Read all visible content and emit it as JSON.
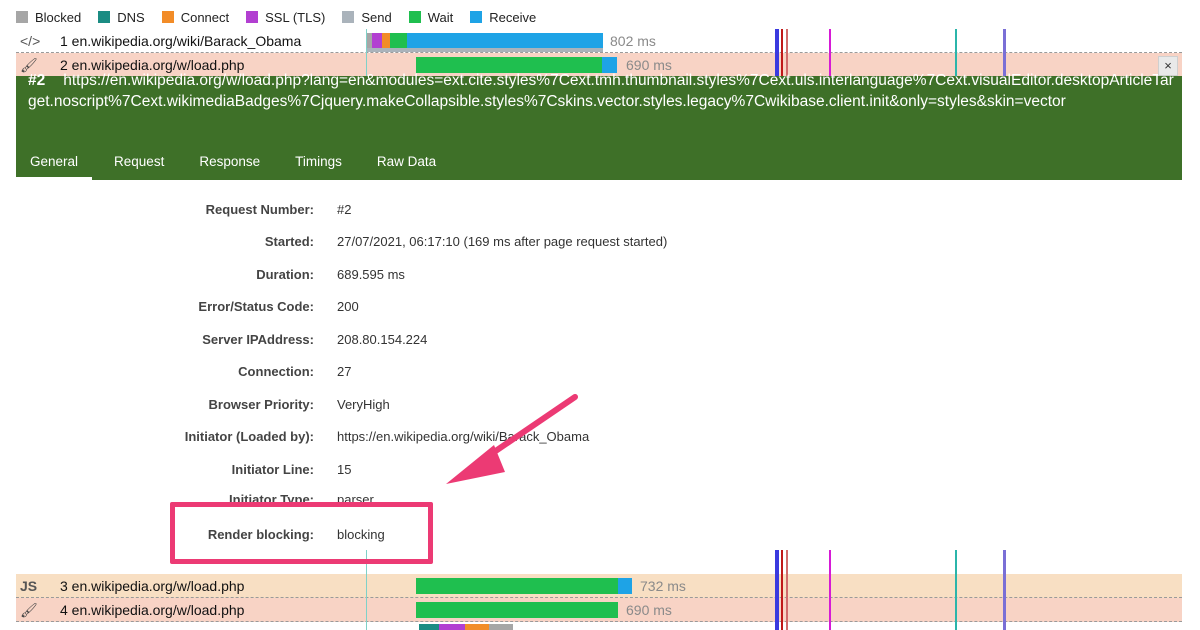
{
  "legend": [
    {
      "label": "Blocked",
      "color": "#a6a6a6"
    },
    {
      "label": "DNS",
      "color": "#1b8c83"
    },
    {
      "label": "Connect",
      "color": "#f28c28"
    },
    {
      "label": "SSL (TLS)",
      "color": "#b23fd1"
    },
    {
      "label": "Send",
      "color": "#aab3bb"
    },
    {
      "label": "Wait",
      "color": "#1fbf4f"
    },
    {
      "label": "Receive",
      "color": "#1ea3e6"
    }
  ],
  "rows": [
    {
      "num": "1",
      "label": "1 en.wikipedia.org/wiki/Barack_Obama",
      "icon": "html-icon",
      "duration": "802 ms"
    },
    {
      "num": "2",
      "label": "2 en.wikipedia.org/w/load.php",
      "icon": "brush-icon",
      "duration": "690 ms"
    },
    {
      "num": "3",
      "label": "3 en.wikipedia.org/w/load.php",
      "icon": "js-icon",
      "duration": "732 ms"
    },
    {
      "num": "4",
      "label": "4 en.wikipedia.org/w/load.php",
      "icon": "brush-icon",
      "duration": "690 ms"
    }
  ],
  "row_icon_text": {
    "html": "</>",
    "js": "JS",
    "brush": "🖌"
  },
  "panel": {
    "request_tag": "#2",
    "url": "https://en.wikipedia.org/w/load.php?lang=en&modules=ext.cite.styles%7Cext.tmh.thumbnail.styles%7Cext.uls.interlanguage%7Cext.visualEditor.desktopArticleTarget.noscript%7Cext.wikimediaBadges%7Cjquery.makeCollapsible.styles%7Cskins.vector.styles.legacy%7Cwikibase.client.init&only=styles&skin=vector",
    "close": "×",
    "tabs": [
      "General",
      "Request",
      "Response",
      "Timings",
      "Raw Data"
    ]
  },
  "details": [
    {
      "label": "Request Number:",
      "value": "#2"
    },
    {
      "label": "Started:",
      "value": "27/07/2021, 06:17:10 (169 ms after page request started)"
    },
    {
      "label": "Duration:",
      "value": "689.595 ms"
    },
    {
      "label": "Error/Status Code:",
      "value": "200"
    },
    {
      "label": "Server IPAddress:",
      "value": "208.80.154.224"
    },
    {
      "label": "Connection:",
      "value": "27"
    },
    {
      "label": "Browser Priority:",
      "value": "VeryHigh"
    },
    {
      "label": "Initiator (Loaded by):",
      "value": "https://en.wikipedia.org/wiki/Barack_Obama"
    },
    {
      "label": "Initiator Line:",
      "value": "15"
    },
    {
      "label": "Initiator Type:",
      "value": "parser"
    },
    {
      "label": "Render blocking:",
      "value": "blocking"
    }
  ]
}
